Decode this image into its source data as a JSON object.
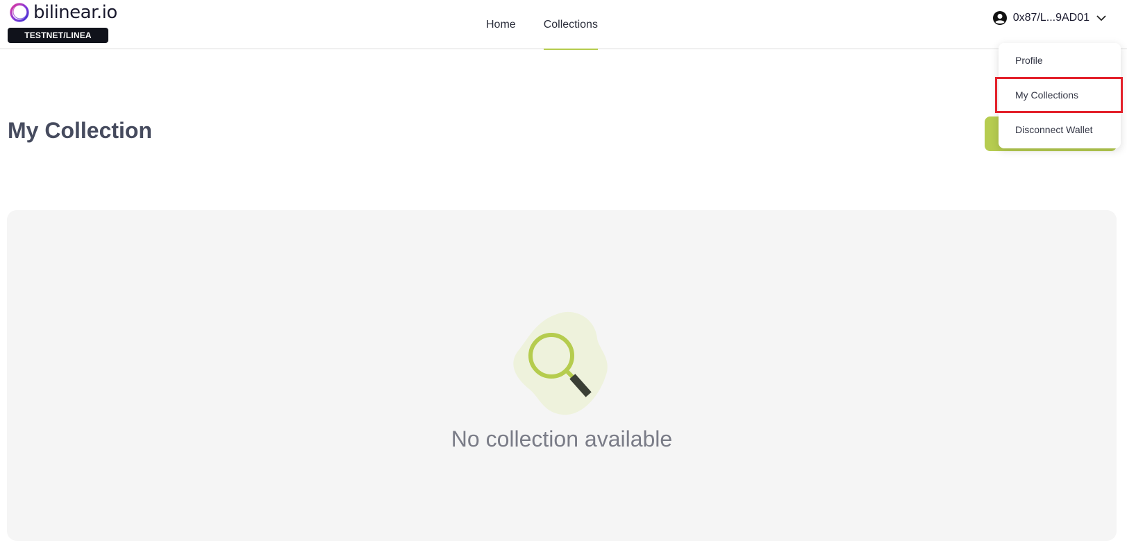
{
  "header": {
    "logo_text": "bilinear.io",
    "network_badge": "TESTNET/LINEA",
    "nav": [
      {
        "label": "Home",
        "active": false
      },
      {
        "label": "Collections",
        "active": true
      }
    ],
    "wallet_address": "0x87/L...9AD01",
    "wallet_icon": "user-circle-icon",
    "chevron_icon": "chevron-down-icon"
  },
  "dropdown": {
    "items": [
      {
        "label": "Profile"
      },
      {
        "label": "My Collections",
        "highlighted": true
      },
      {
        "label": "Disconnect Wallet"
      }
    ]
  },
  "main": {
    "title": "My Collection",
    "empty_state": {
      "icon": "magnifier-icon",
      "text": "No collection available"
    }
  },
  "colors": {
    "accent": "#b6cc50",
    "highlight_border": "#e3212b",
    "badge_bg": "#10121b",
    "card_bg": "#f5f5f5"
  }
}
